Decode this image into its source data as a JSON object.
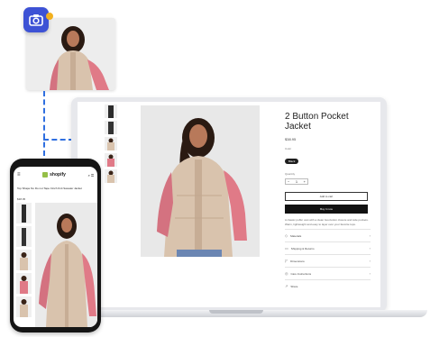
{
  "colors": {
    "camera_badge": "#3d52d5",
    "badge_dot": "#f2b01e",
    "connector": "#2f6fe0",
    "shopify_green": "#95bf47"
  },
  "icons": {
    "camera": "camera-icon",
    "menu": "hamburger-menu-icon",
    "search": "search-icon",
    "cart": "cart-icon",
    "chevron": "chevron-right-icon"
  },
  "product": {
    "vendor": "",
    "title": "2 Button Pocket Jacket",
    "price": "$38.95",
    "color_label": "Color",
    "color_value": "Black",
    "quantity_label": "Quantity",
    "quantity": "1",
    "add_to_cart": "Add to cart",
    "buy_now": "Buy it now",
    "description": "A classic puffer vest with a clean two-button closure and side pockets. Warm, lightweight and easy to layer over your favorite tops.",
    "accordion": [
      {
        "icon": "materials-icon",
        "label": "Materials"
      },
      {
        "icon": "shipping-icon",
        "label": "Shipping & Returns"
      },
      {
        "icon": "dimensions-icon",
        "label": "Dimensions"
      },
      {
        "icon": "care-icon",
        "label": "Care Instructions"
      },
      {
        "icon": "share-icon",
        "label": "Share"
      }
    ]
  },
  "mobile": {
    "logo": "shopify",
    "title": "Top Shape No Do not Tape Cinch Knit Sweater Jacket",
    "price": "$38.95"
  }
}
